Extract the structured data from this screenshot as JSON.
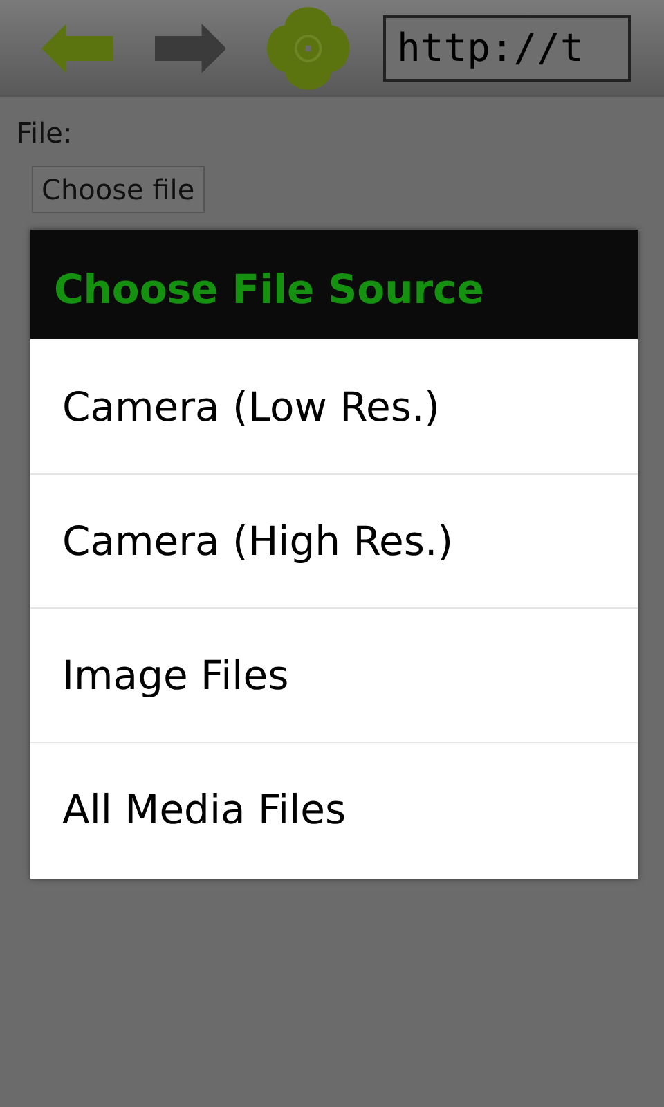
{
  "toolbar": {
    "url": "http://t"
  },
  "form": {
    "label": "File:",
    "choose_button": "Choose file"
  },
  "dialog": {
    "title": "Choose File Source",
    "options": [
      {
        "label": "Camera (Low Res.)"
      },
      {
        "label": "Camera (High Res.)"
      },
      {
        "label": "Image Files"
      },
      {
        "label": "All Media Files"
      }
    ]
  }
}
